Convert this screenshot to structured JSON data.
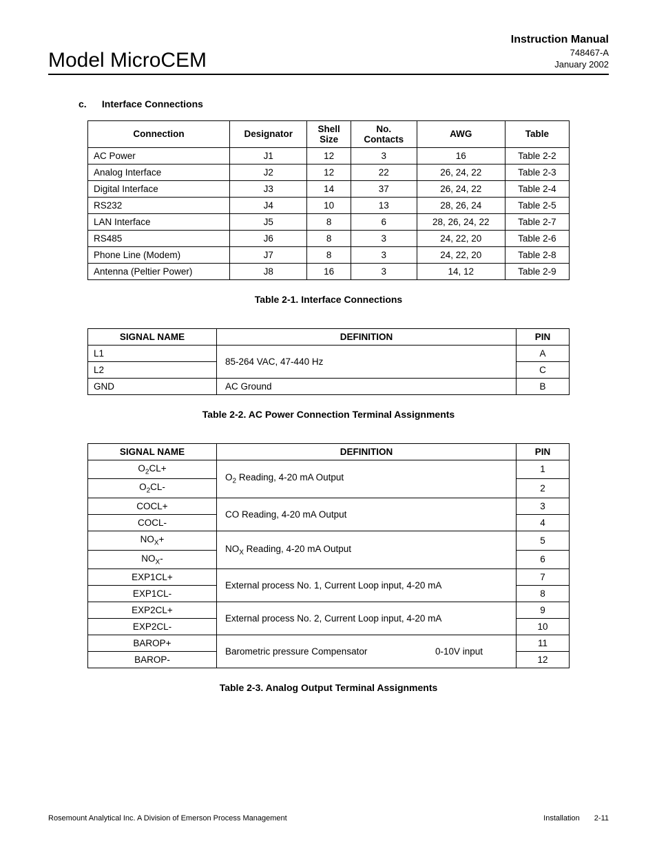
{
  "header": {
    "model": "Model MicroCEM",
    "manual": "Instruction Manual",
    "doc_num": "748467-A",
    "date": "January 2002"
  },
  "section": {
    "letter": "c.",
    "title": "Interface Connections"
  },
  "table1": {
    "headers": [
      "Connection",
      "Designator",
      "Shell Size",
      "No. Contacts",
      "AWG",
      "Table"
    ],
    "rows": [
      [
        "AC Power",
        "J1",
        "12",
        "3",
        "16",
        "Table 2-2"
      ],
      [
        "Analog Interface",
        "J2",
        "12",
        "22",
        "26, 24, 22",
        "Table 2-3"
      ],
      [
        "Digital Interface",
        "J3",
        "14",
        "37",
        "26, 24, 22",
        "Table 2-4"
      ],
      [
        "RS232",
        "J4",
        "10",
        "13",
        "28, 26, 24",
        "Table 2-5"
      ],
      [
        "LAN Interface",
        "J5",
        "8",
        "6",
        "28, 26, 24, 22",
        "Table 2-7"
      ],
      [
        "RS485",
        "J6",
        "8",
        "3",
        "24, 22, 20",
        "Table 2-6"
      ],
      [
        "Phone Line (Modem)",
        "J7",
        "8",
        "3",
        "24, 22, 20",
        "Table 2-8"
      ],
      [
        "Antenna (Peltier Power)",
        "J8",
        "16",
        "3",
        "14, 12",
        "Table 2-9"
      ]
    ],
    "caption": "Table 2-1.  Interface Connections"
  },
  "table2": {
    "headers": [
      "SIGNAL NAME",
      "DEFINITION",
      "PIN"
    ],
    "rows": [
      {
        "name": "L1",
        "def": "85-264 VAC, 47-440 Hz",
        "pin": "A",
        "rowspan": 2
      },
      {
        "name": "L2",
        "pin": "C"
      },
      {
        "name": "GND",
        "def": "AC Ground",
        "pin": "B",
        "rowspan": 1
      }
    ],
    "caption": "Table 2-2. AC Power Connection Terminal Assignments"
  },
  "table3": {
    "headers": [
      "SIGNAL NAME",
      "DEFINITION",
      "PIN"
    ],
    "groups": [
      {
        "names": [
          "O2CL+",
          "O2CL-"
        ],
        "name_html": [
          "O<sub>2</sub>CL+",
          "O<sub>2</sub>CL-"
        ],
        "def_html": "O<sub>2</sub> Reading, 4-20 mA Output",
        "pins": [
          "1",
          "2"
        ]
      },
      {
        "names": [
          "COCL+",
          "COCL-"
        ],
        "name_html": [
          "COCL+",
          "COCL-"
        ],
        "def_html": "CO Reading, 4-20 mA Output",
        "pins": [
          "3",
          "4"
        ]
      },
      {
        "names": [
          "NOX+",
          "NOX-"
        ],
        "name_html": [
          "NO<sub>X</sub>+",
          "NO<sub>X</sub>-"
        ],
        "def_html": "NO<sub>X</sub> Reading, 4-20 mA Output",
        "pins": [
          "5",
          "6"
        ]
      },
      {
        "names": [
          "EXP1CL+",
          "EXP1CL-"
        ],
        "name_html": [
          "EXP1CL+",
          "EXP1CL-"
        ],
        "def_html": "External process No. 1, Current Loop input, 4-20 mA",
        "pins": [
          "7",
          "8"
        ]
      },
      {
        "names": [
          "EXP2CL+",
          "EXP2CL-"
        ],
        "name_html": [
          "EXP2CL+",
          "EXP2CL-"
        ],
        "def_html": "External process No. 2, Current Loop input, 4-20 mA",
        "pins": [
          "9",
          "10"
        ]
      },
      {
        "names": [
          "BAROP+",
          "BAROP-"
        ],
        "name_html": [
          "BAROP+",
          "BAROP-"
        ],
        "def_html": "<span class='def-spread'><span>Barometric pressure Compensator</span><span>0-10V input</span></span>",
        "pins": [
          "11",
          "12"
        ]
      }
    ],
    "caption": "Table 2-3.    Analog Output Terminal Assignments"
  },
  "footer": {
    "left": "Rosemount Analytical Inc.    A Division of Emerson Process Management",
    "right_label": "Installation",
    "right_page": "2-11"
  }
}
